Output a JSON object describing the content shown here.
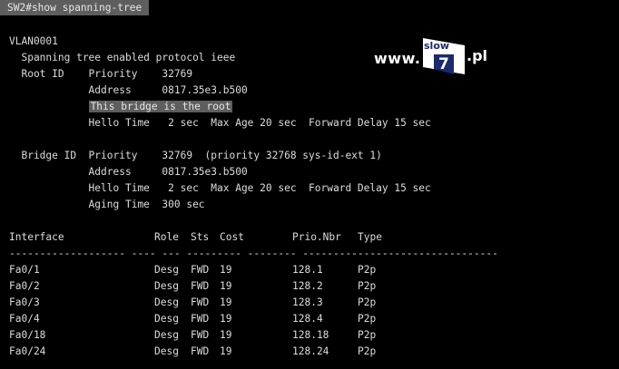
{
  "command": "SW2#show spanning-tree",
  "logo": {
    "www": "www.",
    "word": "slow",
    "digit": "7",
    "tld": ".pl"
  },
  "vlan": "VLAN0001",
  "protocol_line": "  Spanning tree enabled protocol ieee",
  "root_id": {
    "priority_line": "  Root ID    Priority    32769",
    "address_line": "             Address     0817.35e3.b500",
    "is_root_text": "This bridge is the root",
    "hello_line": "             Hello Time   2 sec  Max Age 20 sec  Forward Delay 15 sec"
  },
  "bridge_id": {
    "priority_line": "  Bridge ID  Priority    32769  (priority 32768 sys-id-ext 1)",
    "address_line": "             Address     0817.35e3.b500",
    "hello_line": "             Hello Time   2 sec  Max Age 20 sec  Forward Delay 15 sec",
    "aging_line": "             Aging Time  300 sec"
  },
  "table": {
    "headers": [
      "Interface",
      "Role",
      "Sts",
      "Cost",
      "Prio.Nbr",
      "Type"
    ],
    "separator": "------------------- ---- --- --------- -------- --------------------------------",
    "rows": [
      [
        "Fa0/1",
        "Desg",
        "FWD",
        "19",
        "128.1",
        "P2p"
      ],
      [
        "Fa0/2",
        "Desg",
        "FWD",
        "19",
        "128.2",
        "P2p"
      ],
      [
        "Fa0/3",
        "Desg",
        "FWD",
        "19",
        "128.3",
        "P2p"
      ],
      [
        "Fa0/4",
        "Desg",
        "FWD",
        "19",
        "128.4",
        "P2p"
      ],
      [
        "Fa0/18",
        "Desg",
        "FWD",
        "19",
        "128.18",
        "P2p"
      ],
      [
        "Fa0/24",
        "Desg",
        "FWD",
        "19",
        "128.24",
        "P2p"
      ]
    ]
  }
}
